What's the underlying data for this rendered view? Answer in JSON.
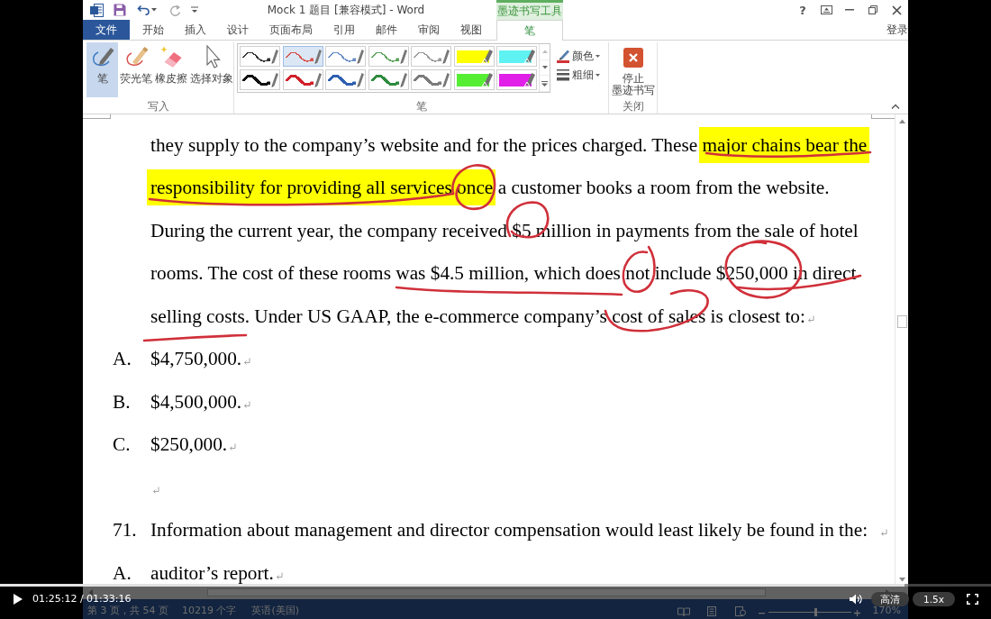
{
  "window": {
    "title": "Mock 1 题目 [兼容模式] - Word",
    "context_group": "墨迹书写工具",
    "help": "?",
    "sign_in": "登录"
  },
  "tabs": [
    {
      "label": "文件",
      "kind": "file",
      "selected": false
    },
    {
      "label": "开始",
      "kind": "normal",
      "selected": false
    },
    {
      "label": "插入",
      "kind": "normal",
      "selected": false
    },
    {
      "label": "设计",
      "kind": "normal",
      "selected": false
    },
    {
      "label": "页面布局",
      "kind": "normal",
      "selected": false
    },
    {
      "label": "引用",
      "kind": "normal",
      "selected": false
    },
    {
      "label": "邮件",
      "kind": "normal",
      "selected": false
    },
    {
      "label": "审阅",
      "kind": "normal",
      "selected": false
    },
    {
      "label": "视图",
      "kind": "normal",
      "selected": false
    },
    {
      "label": "笔",
      "kind": "contextual",
      "selected": true
    }
  ],
  "ribbon": {
    "write": {
      "label": "写入",
      "tools": [
        {
          "label": "笔",
          "kind": "pen",
          "selected": true
        },
        {
          "label": "荧光笔",
          "kind": "highlighter",
          "selected": false
        },
        {
          "label": "橡皮擦",
          "kind": "eraser",
          "selected": false
        },
        {
          "label": "选择对象",
          "kind": "select",
          "selected": false
        }
      ]
    },
    "pens": {
      "label": "笔",
      "styles": [
        {
          "kind": "thin",
          "color": "#333333",
          "selected": false
        },
        {
          "kind": "thin",
          "color": "#d9534f",
          "selected": true
        },
        {
          "kind": "thin",
          "color": "#6a8fc7",
          "selected": false
        },
        {
          "kind": "thin",
          "color": "#5ba35b",
          "selected": false
        },
        {
          "kind": "thin",
          "color": "#9a9a9a",
          "selected": false
        },
        {
          "kind": "highlighter",
          "color": "#ffff00",
          "selected": false
        },
        {
          "kind": "highlighter",
          "color": "#5ff2f2",
          "selected": false
        },
        {
          "kind": "thick",
          "color": "#111111",
          "selected": false
        },
        {
          "kind": "thick",
          "color": "#d0202a",
          "selected": false
        },
        {
          "kind": "thick",
          "color": "#2e5fb0",
          "selected": false
        },
        {
          "kind": "thick",
          "color": "#2e8b3e",
          "selected": false
        },
        {
          "kind": "thick",
          "color": "#7a7a7a",
          "selected": false
        },
        {
          "kind": "highlighter",
          "color": "#55ee33",
          "selected": false
        },
        {
          "kind": "highlighter",
          "color": "#e020e8",
          "selected": false
        }
      ],
      "options": [
        {
          "label": "颜色",
          "kind": "color"
        },
        {
          "label": "粗细",
          "kind": "thickness"
        }
      ]
    },
    "close": {
      "label": "关闭",
      "button_lines": [
        "停止",
        "墨迹书写"
      ]
    }
  },
  "document": {
    "show_formatting_marks": true,
    "blocks": [
      {
        "kind": "paragraph",
        "segments": [
          {
            "text": "they supply to the company’s website and for the prices charged. These ",
            "highlighted": false
          },
          {
            "text": "major chains bear the responsibility for providing all services once",
            "highlighted": true
          },
          {
            "text": " a customer books a room from the website. During the current year, the company received $5 million in payments from the sale of hotel rooms. The cost of these rooms was $4.5 million, which does not include $250,000 in direct selling costs. Under US GAAP, the e-commerce company’s cost of sales is closest to:",
            "highlighted": false
          }
        ]
      },
      {
        "kind": "option",
        "marker": "A.",
        "text": "$4,750,000."
      },
      {
        "kind": "option",
        "marker": "B.",
        "text": "$4,500,000."
      },
      {
        "kind": "option",
        "marker": "C.",
        "text": "$250,000."
      },
      {
        "kind": "empty"
      },
      {
        "kind": "question",
        "marker": "71.",
        "text": "Information about management and director compensation would least likely be found in the:"
      },
      {
        "kind": "option",
        "marker": "A.",
        "text": "auditor’s report."
      }
    ]
  },
  "status_bar": {
    "page": "第 3 页，共 54 页",
    "words": "10219 个字",
    "language": "英语(美国)",
    "zoom": "170%",
    "zoom_slider": {
      "level": 0.58
    }
  },
  "video_player": {
    "paused": true,
    "time": "01:25:12 / 01:33:16",
    "progress": {
      "level": 0.913
    },
    "quality": "高清",
    "speed": "1.5x"
  }
}
